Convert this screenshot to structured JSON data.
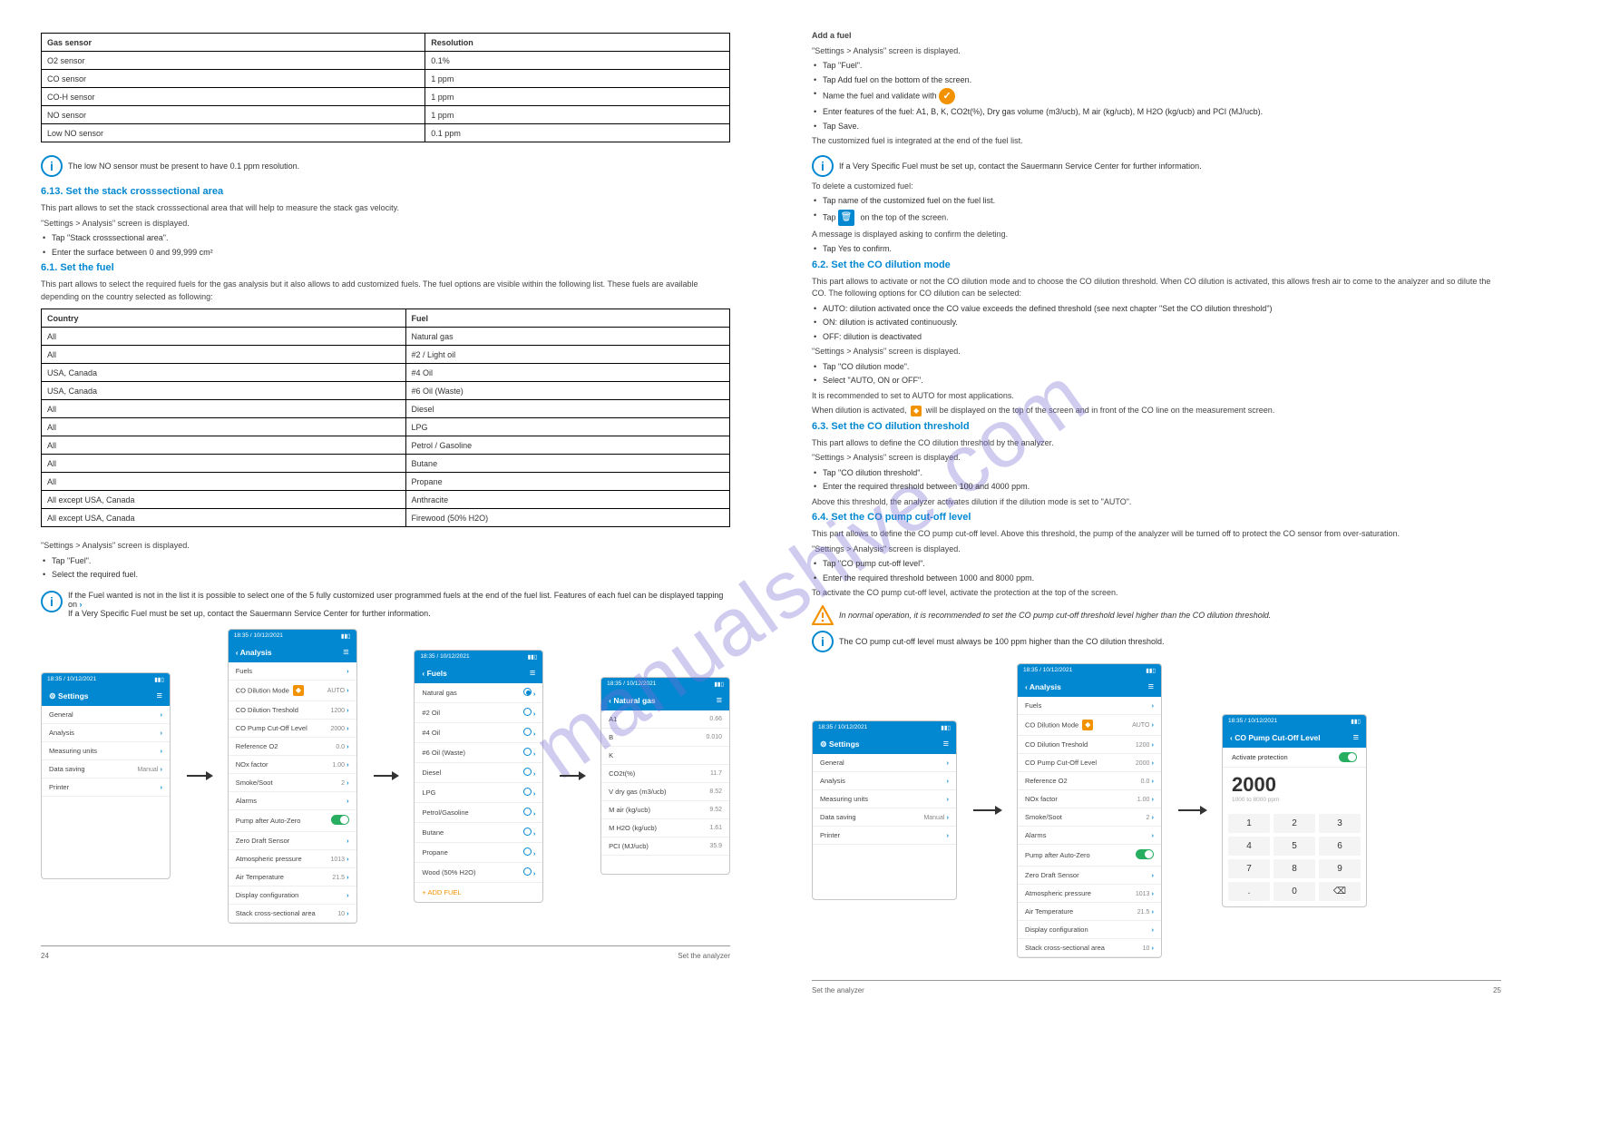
{
  "watermark": "manualshive.com",
  "left": {
    "table1": {
      "header1": "Gas sensor",
      "header2": "Resolution",
      "rows": [
        [
          "O2 sensor",
          "0.1%"
        ],
        [
          "CO sensor",
          "1 ppm"
        ],
        [
          "CO-H sensor",
          "1 ppm"
        ],
        [
          "NO sensor",
          "1 ppm"
        ],
        [
          "Low NO sensor",
          "0.1 ppm"
        ]
      ]
    },
    "lowNOLine": "The low NO sensor must be present to have 0.1 ppm resolution.",
    "section_stack": "6.13. Set the stack crosssectional area",
    "stack_para": "This part allows to set the stack crosssectional area that will help to measure the stack gas velocity.",
    "stack_screen": "\"Settings > Analysis\" screen is displayed.",
    "stack_tap": "Tap \"Stack crosssectional area\".",
    "stack_enter": "Enter the surface between 0 and 99,999 cm²",
    "section_fuel": "6.1. Set the fuel",
    "fuel_para": "This part allows to select the required fuels for the gas analysis but it also allows to add customized fuels. The fuel options are visible within the following list. These fuels are available depending on the country selected as following:",
    "table2": {
      "header1": "Country",
      "header2": "Fuel",
      "rows": [
        [
          "All",
          "Natural gas"
        ],
        [
          "All",
          "#2 / Light oil"
        ],
        [
          "USA, Canada",
          "#4 Oil"
        ],
        [
          "USA, Canada",
          "#6 Oil (Waste)"
        ],
        [
          "All",
          "Diesel"
        ],
        [
          "All",
          "LPG"
        ],
        [
          "All",
          "Petrol / Gasoline"
        ],
        [
          "All",
          "Butane"
        ],
        [
          "All",
          "Propane"
        ],
        [
          "All except USA, Canada",
          "Anthracite"
        ],
        [
          "All except USA, Canada",
          "Firewood (50% H2O)"
        ]
      ]
    },
    "fuel_screen": "\"Settings > Analysis\" screen is displayed.",
    "fuel_tap": "Tap \"Fuel\".",
    "fuel_select": "Select the required fuel.",
    "info_features": "If the Fuel wanted is not in the list it is possible to select one of the 5 fully customized user programmed fuels at the end of the fuel list. Features of each fuel can be displayed tapping on",
    "info_fuelset": "If a Very Specific Fuel must be set up, contact the Sauermann Service Center for further information.",
    "add_fuel_head": "Add a fuel",
    "add_screen": "\"Settings > Analysis\" screen is displayed.",
    "add_tap": "Tap \"Fuel\".",
    "add_action": "Tap Add fuel on the bottom of the screen.",
    "add_name": "Name the fuel and validate with",
    "add_enter": "Enter features of the fuel: A1, B, K, CO2t(%), Dry gas volume (m3/ucb), M air (kg/ucb), M H2O (kg/ucb) and PCI (MJ/ucb).",
    "add_save": "Tap Save.",
    "add_list": "The customized fuel is integrated at the end of the fuel list.",
    "add_delete": "To delete a customized fuel:",
    "add_delete_tap": "Tap name of the customized fuel on the fuel list.",
    "add_trash": "Tap",
    "add_trash_end": "on the top of the screen.",
    "add_confirm": "A message is displayed asking to confirm the deleting.",
    "add_yes": "Tap Yes to confirm.",
    "flow1": {
      "status_time": "18:35 / 10/12/2021",
      "settings_title": "Settings",
      "settings": [
        "General",
        "Analysis",
        "Measuring units",
        "Data saving",
        "Printer"
      ],
      "data_saving_val": "Manual",
      "analysis_title": "Analysis",
      "analysis_rows": [
        {
          "l": "Fuels",
          "v": ""
        },
        {
          "l": "CO Dilution Mode",
          "v": "AUTO",
          "shield": true
        },
        {
          "l": "CO Dilution Treshold",
          "v": "1200"
        },
        {
          "l": "CO Pump Cut-Off Level",
          "v": "2000"
        },
        {
          "l": "Reference O2",
          "v": "0.0"
        },
        {
          "l": "NOx factor",
          "v": "1.00"
        },
        {
          "l": "Smoke/Soot",
          "v": "2"
        },
        {
          "l": "Alarms",
          "v": ""
        },
        {
          "l": "Pump after Auto-Zero",
          "v": "",
          "toggle": true
        },
        {
          "l": "Zero Draft Sensor",
          "v": ""
        },
        {
          "l": "Atmospheric pressure",
          "v": "1013"
        },
        {
          "l": "Air Temperature",
          "v": "21.5"
        },
        {
          "l": "Display configuration",
          "v": ""
        },
        {
          "l": "Stack cross-sectional area",
          "v": "10"
        }
      ],
      "fuels_title": "Fuels",
      "fuels_rows": [
        "Natural gas",
        "#2 Oil",
        "#4 Oil",
        "#6 Oil (Waste)",
        "Diesel",
        "LPG",
        "Petrol/Gasoline",
        "Butane",
        "Propane",
        "Wood (50% H2O)"
      ],
      "fuels_add": "+  ADD FUEL",
      "ng_title": "Natural gas",
      "ng_rows": [
        {
          "l": "A1",
          "v": "0.66"
        },
        {
          "l": "B",
          "v": "0.010"
        },
        {
          "l": "K",
          "v": ""
        },
        {
          "l": "CO2t(%)",
          "v": "11.7"
        },
        {
          "l": "V dry gas (m3/ucb)",
          "v": "8.52"
        },
        {
          "l": "M air (kg/ucb)",
          "v": "9.52"
        },
        {
          "l": "M H2O (kg/ucb)",
          "v": "1.61"
        },
        {
          "l": "PCI (MJ/ucb)",
          "v": "35.9"
        }
      ]
    },
    "footer_left": "24",
    "footer_right": "Set the analyzer"
  },
  "right": {
    "section_co": "6.2. Set the CO dilution mode",
    "co_para": "This part allows to activate or not the CO dilution mode and to choose the CO dilution threshold. When CO dilution is activated, this allows fresh air to come to the analyzer and so dilute the CO. The following options for CO dilution can be selected:",
    "co_auto": "AUTO: dilution activated once the CO value exceeds the defined threshold (see next chapter \"Set the CO dilution threshold\")",
    "co_on": "ON: dilution is activated continuously.",
    "co_off": "OFF: dilution is deactivated",
    "co_screen": "\"Settings > Analysis\" screen is displayed.",
    "co_tap": "Tap \"CO dilution mode\".",
    "co_select": "Select \"AUTO, ON or OFF\".",
    "co_reco": "It is recommended to set to AUTO for most applications.",
    "co_icon": "When dilution is activated,",
    "co_icon_end": "will be displayed on the top of the screen and in front of the CO line on the measurement screen.",
    "section_thresh": "6.3. Set the CO dilution threshold",
    "thresh_para": "This part allows to define the CO dilution threshold by the analyzer.",
    "thresh_screen": "\"Settings > Analysis\" screen is displayed.",
    "thresh_tap": "Tap \"CO dilution threshold\".",
    "thresh_enter": "Enter the required threshold between 100 and 4000 ppm.",
    "thresh_above": "Above this threshold, the analyzer activates dilution if the dilution mode is set to \"AUTO\".",
    "section_cutoff": "6.4. Set the CO pump cut-off level",
    "cutoff_para": "This part allows to define the CO pump cut-off level. Above this threshold, the pump of the analyzer will be turned off to protect the CO sensor from over-saturation.",
    "cutoff_screen": "\"Settings > Analysis\" screen is displayed.",
    "cutoff_tap": "Tap \"CO pump cut-off level\".",
    "cutoff_enter": "Enter the required threshold between 1000 and 8000 ppm.",
    "cutoff_act_head": "To activate the CO pump cut-off level, activate the protection at the top of the screen.",
    "cutoff_normal": "In normal operation, it is recommended to set the CO pump cut-off threshold level higher than the CO dilution threshold.",
    "cutoff_note": "The CO pump cut-off level must always be 100 ppm higher than the CO dilution threshold.",
    "flow2": {
      "co_title": "CO Pump Cut-Off Level",
      "activate": "Activate protection",
      "big": "2000",
      "hint": "1000 to 8000 ppm",
      "keys": [
        "1",
        "2",
        "3",
        "4",
        "5",
        "6",
        "7",
        "8",
        "9",
        ".",
        "0",
        "⌫"
      ]
    },
    "footer_left": "Set the analyzer",
    "footer_right": "25"
  }
}
